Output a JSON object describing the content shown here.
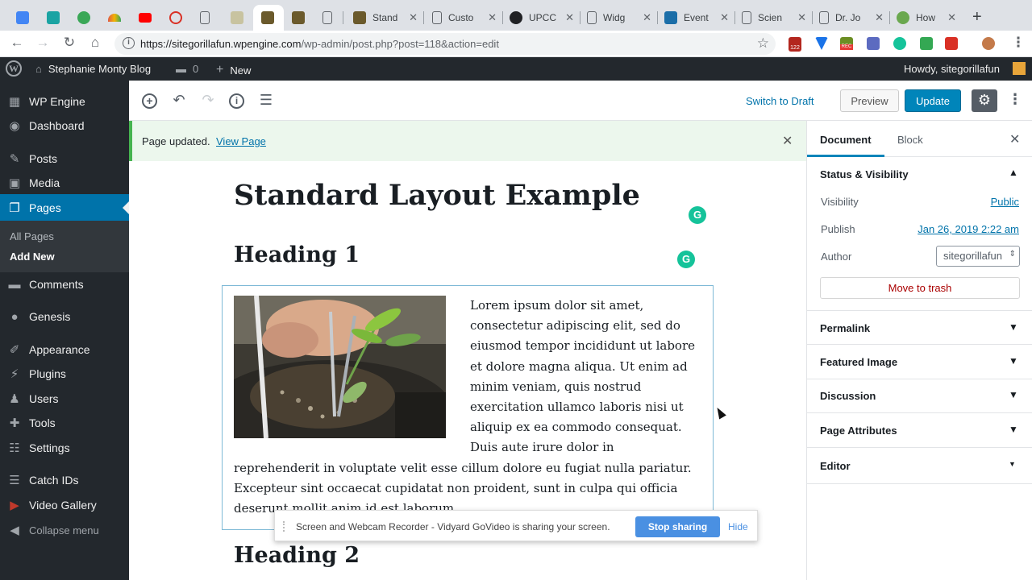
{
  "browser": {
    "tabs": [
      {
        "title": "",
        "icon": "calendar-icon",
        "color": "#4285f4"
      },
      {
        "title": "",
        "icon": "grid-icon",
        "color": "#1aa3a3"
      },
      {
        "title": "",
        "icon": "mountain-icon",
        "color": "#3aa757"
      },
      {
        "title": "",
        "icon": "rainbow-icon",
        "color": "#e05a47"
      },
      {
        "title": "",
        "icon": "youtube-icon",
        "color": "#ff0000"
      },
      {
        "title": "",
        "icon": "gears-icon",
        "color": "#d93025"
      },
      {
        "title": "",
        "icon": "page-icon",
        "color": "#ffffff"
      },
      {
        "title": "",
        "icon": "photo-icon",
        "color": "#9aa0a6"
      },
      {
        "title": "",
        "icon": "gorilla-icon",
        "color": "#6b5a2c"
      },
      {
        "title": "",
        "icon": "gorilla-icon",
        "color": "#6b5a2c"
      },
      {
        "title": "",
        "icon": "acrobat-icon",
        "color": "#ffffff"
      },
      {
        "title": "Stand",
        "icon": "gorilla-icon",
        "color": "#6b5a2c"
      },
      {
        "title": "Custo",
        "icon": "page-icon",
        "color": "#ffffff"
      },
      {
        "title": "UPCC",
        "icon": "github-icon",
        "color": "#202124"
      },
      {
        "title": "Widg",
        "icon": "page-icon",
        "color": "#ffffff"
      },
      {
        "title": "Event",
        "icon": "cube-icon",
        "color": "#1b6ea8"
      },
      {
        "title": "Scien",
        "icon": "page-icon",
        "color": "#ffffff"
      },
      {
        "title": "Dr. Jo",
        "icon": "page-icon",
        "color": "#ffffff"
      },
      {
        "title": "How",
        "icon": "gear-green-icon",
        "color": "#6aa84f"
      }
    ],
    "url_host": "https://sitegorillafun.wpengine.com",
    "url_path": "/wp-admin/post.php?post=118&action=edit",
    "ext_badge_count": "122",
    "ext_rec": "REC"
  },
  "adminbar": {
    "site_name": "Stephanie Monty Blog",
    "comments_count": "0",
    "new_label": "New",
    "howdy": "Howdy, sitegorillafun"
  },
  "menu": {
    "items": [
      {
        "label": "WP Engine",
        "icon": "wpengine-icon"
      },
      {
        "label": "Dashboard",
        "icon": "dashboard-icon"
      },
      {
        "label": "Posts",
        "icon": "pin-icon"
      },
      {
        "label": "Media",
        "icon": "media-icon"
      },
      {
        "label": "Pages",
        "icon": "pages-icon"
      },
      {
        "label": "Comments",
        "icon": "comments-icon"
      },
      {
        "label": "Genesis",
        "icon": "genesis-icon"
      },
      {
        "label": "Appearance",
        "icon": "brush-icon"
      },
      {
        "label": "Plugins",
        "icon": "plugin-icon"
      },
      {
        "label": "Users",
        "icon": "users-icon"
      },
      {
        "label": "Tools",
        "icon": "wrench-icon"
      },
      {
        "label": "Settings",
        "icon": "settings-icon"
      },
      {
        "label": "Catch IDs",
        "icon": "list-icon"
      },
      {
        "label": "Video Gallery",
        "icon": "video-icon"
      },
      {
        "label": "Collapse menu",
        "icon": "collapse-icon"
      }
    ],
    "sub_all_pages": "All Pages",
    "sub_add_new": "Add New"
  },
  "editor": {
    "switch_draft": "Switch to Draft",
    "preview": "Preview",
    "update": "Update",
    "notice": "Page updated.",
    "notice_link": "View Page",
    "title": "Standard Layout Example",
    "heading1": "Heading 1",
    "heading2": "Heading 2",
    "paragraph": "Lorem ipsum dolor sit amet, consectetur adipiscing elit, sed do eiusmod tempor incididunt ut labore et dolore magna aliqua. Ut enim ad minim veniam, quis nostrud exercitation ullamco laboris nisi ut aliquip ex ea commodo consequat. Duis aute irure dolor in reprehenderit in voluptate velit esse cillum dolore eu fugiat nulla pariatur. Excepteur sint occaecat cupidatat non proident, sunt in culpa qui officia deserunt mollit anim id est laborum."
  },
  "share": {
    "text": "Screen and Webcam Recorder - Vidyard GoVideo is sharing your screen.",
    "stop": "Stop sharing",
    "hide": "Hide"
  },
  "sidebar": {
    "tab_document": "Document",
    "tab_block": "Block",
    "status_title": "Status & Visibility",
    "visibility_label": "Visibility",
    "visibility_value": "Public",
    "publish_label": "Publish",
    "publish_value": "Jan 26, 2019 2:22 am",
    "author_label": "Author",
    "author_value": "sitegorillafun",
    "trash": "Move to trash",
    "panels": [
      "Permalink",
      "Featured Image",
      "Discussion",
      "Page Attributes",
      "Editor"
    ]
  },
  "colors": {
    "admin_bg": "#23282d",
    "accent": "#0073aa",
    "update_btn": "#0085ba",
    "notice_border": "#46b450",
    "grammarly": "#15c39a"
  }
}
